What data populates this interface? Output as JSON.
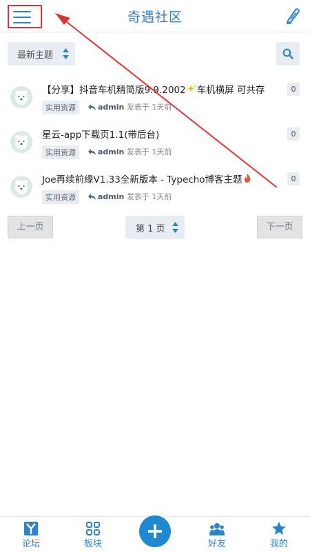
{
  "header": {
    "title": "奇遇社区",
    "menu_icon": "hamburger-menu-icon",
    "edit_icon": "pencil-icon"
  },
  "filter": {
    "sort_label": "最新主题",
    "search_icon": "search-icon"
  },
  "topics": [
    {
      "title_before": "【分享】抖音车机精简版9.9.2002",
      "emoji": "sparkles-icon",
      "title_after": "车机横屏 可共存",
      "tag": "实用资源",
      "author": "admin",
      "posted": "发表于 1天前",
      "count": "0"
    },
    {
      "title_before": "星云-app下载页1.1(带后台)",
      "emoji": "",
      "title_after": "",
      "tag": "实用资源",
      "author": "admin",
      "posted": "发表于 1天前",
      "count": "0"
    },
    {
      "title_before": "Joe再续前缘V1.33全新版本 - Typecho博客主题",
      "emoji": "fire-icon",
      "title_after": "",
      "tag": "实用资源",
      "author": "admin",
      "posted": "发表于 1天前",
      "count": "0"
    }
  ],
  "pager": {
    "prev": "上一页",
    "page": "第 1 页",
    "next": "下一页"
  },
  "tabs": [
    {
      "label": "论坛",
      "icon": "forum-y-icon"
    },
    {
      "label": "板块",
      "icon": "grid-icon"
    },
    {
      "label": "好友",
      "icon": "friends-icon"
    },
    {
      "label": "我的",
      "icon": "star-icon"
    }
  ],
  "fab": {
    "label": "+",
    "icon": "plus-icon"
  },
  "colors": {
    "accent": "#2d83c8",
    "fab": "#1e88d0",
    "annotation": "#e23333",
    "chip_bg": "#e7edf2"
  }
}
